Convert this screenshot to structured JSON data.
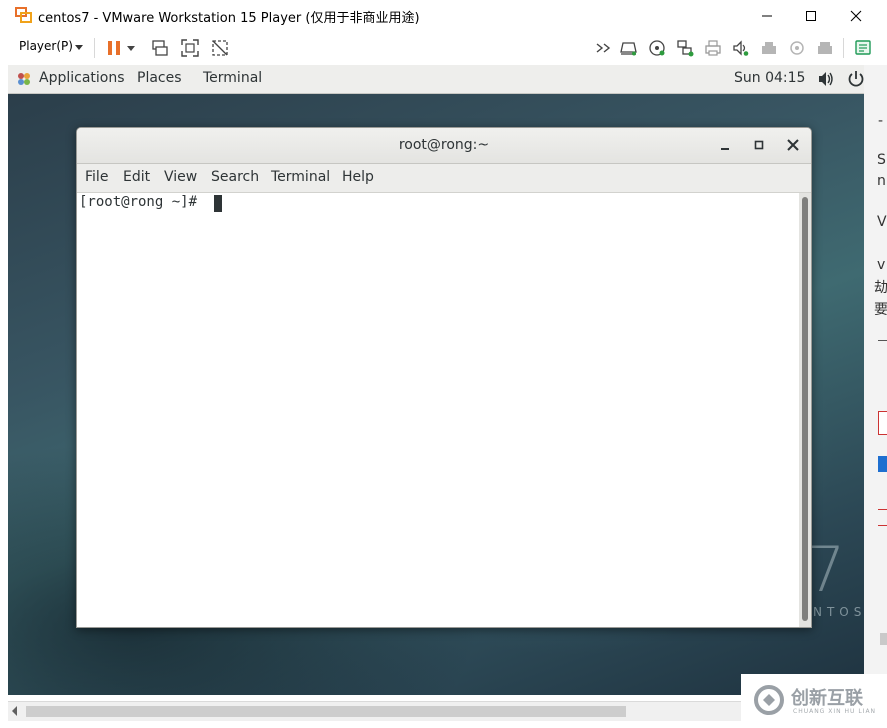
{
  "window": {
    "title": "centos7 - VMware Workstation 15 Player (仅用于非商业用途)"
  },
  "toolbar": {
    "player_menu": "Player(P)",
    "icons": [
      "pause-icon",
      "send-ctrl-alt-del-icon",
      "fullscreen-icon",
      "unity-icon",
      "more-icon",
      "drive-icon",
      "cd-icon",
      "network-icon",
      "printer-icon",
      "sound-icon",
      "usb-icon",
      "disk-icon",
      "storage-icon",
      "message-icon"
    ]
  },
  "gnome": {
    "applications": "Applications",
    "places": "Places",
    "terminal": "Terminal",
    "clock": "Sun 04:15"
  },
  "terminal": {
    "title": "root@rong:~",
    "menu": [
      "File",
      "Edit",
      "View",
      "Search",
      "Terminal",
      "Help"
    ],
    "prompt": "[root@rong ~]# "
  },
  "desktop": {
    "version_digit": "7",
    "brand_partial": "NTOS"
  },
  "right_strip": {
    "chars": [
      "-",
      "S",
      "n",
      "V",
      "v",
      "劫",
      "要"
    ]
  },
  "watermark": {
    "text": "创新互联",
    "sub": "CHUANG XIN HU LIAN"
  },
  "colors": {
    "accent_orange": "#e8702a",
    "vm_bg": "#385562",
    "gnome_bar": "#eeeeec"
  }
}
